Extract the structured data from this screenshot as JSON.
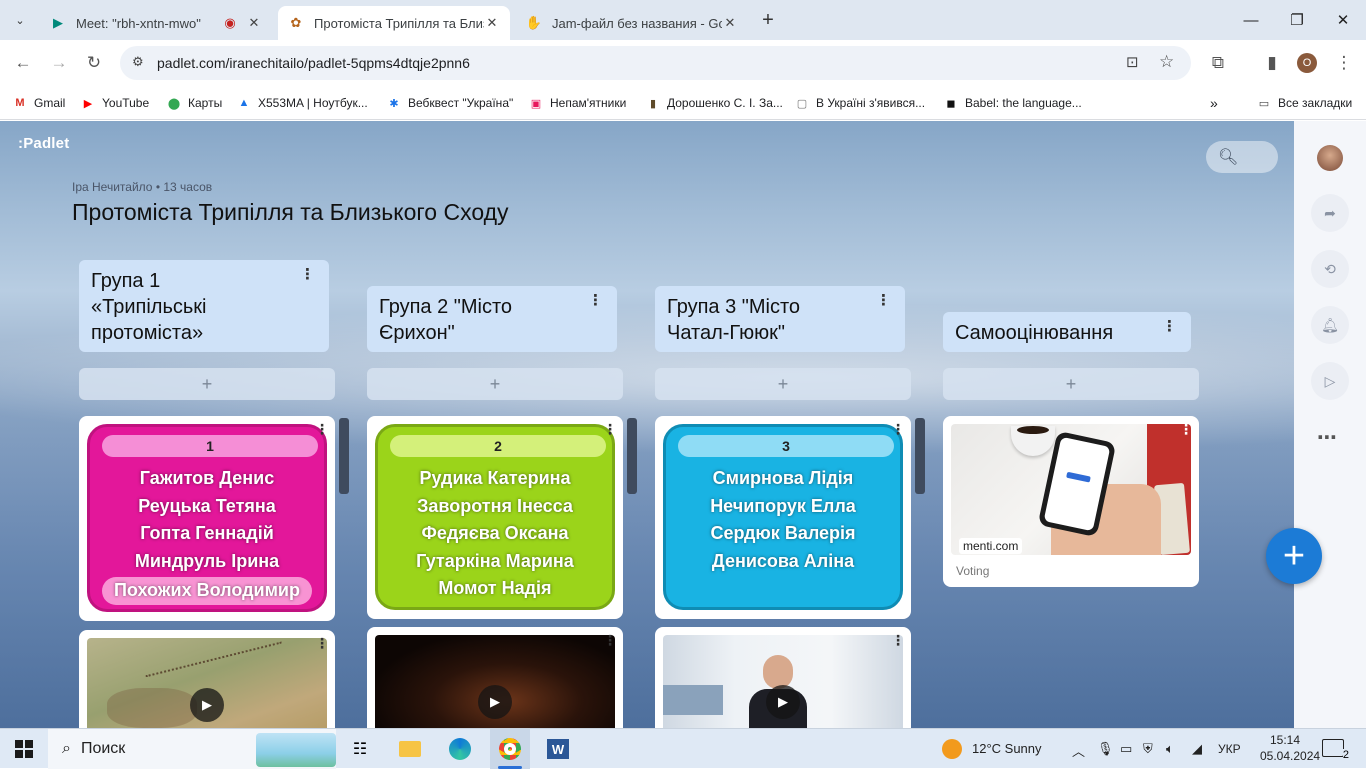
{
  "browser": {
    "tabs": [
      {
        "title": "Meet: \"rbh-xntn-mwo\"",
        "icon": "meet-icon"
      },
      {
        "title": "Протоміста Трипілля та Близь",
        "icon": "padlet-icon",
        "active": true
      },
      {
        "title": "Jam-файл без названия - Goo",
        "icon": "jamboard-icon"
      }
    ],
    "url": "padlet.com/iranechitailo/padlet-5qpms4dtqje2pnn6",
    "profile_initial": "O",
    "bookmarks": [
      {
        "label": "Gmail",
        "icon": "gmail-icon",
        "color": "#d93025",
        "glyph": "M"
      },
      {
        "label": "YouTube",
        "icon": "youtube-icon",
        "color": "#ff0000",
        "glyph": "▶"
      },
      {
        "label": "Карты",
        "icon": "maps-icon",
        "color": "#34a853",
        "glyph": "⬤"
      },
      {
        "label": "X553MA | Ноутбук...",
        "icon": "asus-icon",
        "color": "#1a73e8",
        "glyph": "▲"
      },
      {
        "label": "Вебквест \"Україна\"",
        "icon": "snowflake-icon",
        "color": "#1a73e8",
        "glyph": "✱"
      },
      {
        "label": "Непам'ятники",
        "icon": "nepamyatnyky-icon",
        "color": "#e8175d",
        "glyph": "▣"
      },
      {
        "label": "Дорошенко С. І. За...",
        "icon": "bars-icon",
        "color": "#5f4b2a",
        "glyph": "▮"
      },
      {
        "label": "В Україні з'явився...",
        "icon": "page-icon",
        "color": "#777",
        "glyph": "▢"
      },
      {
        "label": "Babel: the language...",
        "icon": "babel-icon",
        "color": "#111",
        "glyph": "◼"
      }
    ],
    "all_bookmarks": "Все закладки"
  },
  "padlet": {
    "logo": ":Padlet",
    "author": "Іра Нечитайло",
    "time": "13 часов",
    "title": "Протоміста Трипілля та Близького Сходу",
    "columns": [
      {
        "heading": "Група 1 «Трипільські протоміста»",
        "number": "1",
        "names": [
          "Гажитов Денис",
          "Реуцька Тетяна",
          "Гопта Геннадій",
          "Миндруль Ірина",
          "Похожих Володимир"
        ],
        "bg": "#e3179a",
        "pill": "#f58ed6",
        "border": "#c0127f"
      },
      {
        "heading": "Група 2 \"Місто Єрихон\"",
        "number": "2",
        "names": [
          "Рудика Катерина",
          "Заворотня Інесса",
          "Федяєва Оксана",
          "Гутаркіна Марина",
          "Момот Надія"
        ],
        "bg": "#9bd41a",
        "pill": "#d4f07a",
        "border": "#7aa815"
      },
      {
        "heading": "Група 3 \"Місто Чатал-Гююк\"",
        "number": "3",
        "names": [
          "Смирнова Лідія",
          "Нечипорук Елла",
          "Сердюк Валерія",
          "Денисова Аліна"
        ],
        "bg": "#19b3e3",
        "pill": "#8fdcf5",
        "border": "#0f8cb4"
      },
      {
        "heading": "Самооцінювання"
      }
    ],
    "menti_domain": "menti.com",
    "menti_caption": "Voting"
  },
  "taskbar": {
    "search": "Поиск",
    "weather": "12°C  Sunny",
    "lang": "УКР",
    "time": "15:14",
    "date": "05.04.2024",
    "notifications": "2"
  }
}
